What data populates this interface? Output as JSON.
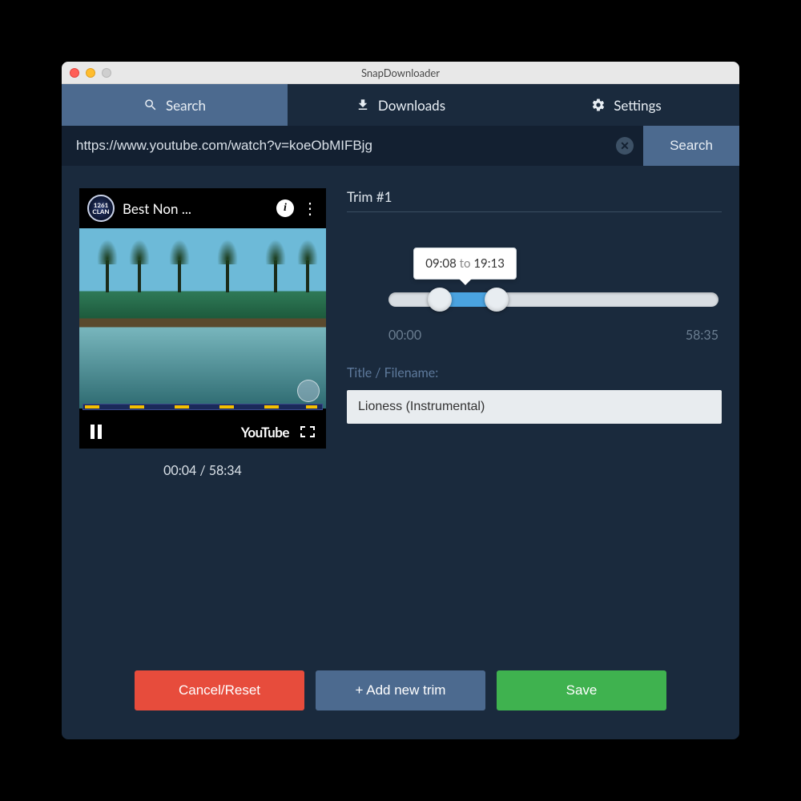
{
  "window": {
    "title": "SnapDownloader"
  },
  "tabs": {
    "search": "Search",
    "downloads": "Downloads",
    "settings": "Settings",
    "active": "search"
  },
  "search": {
    "url": "https://www.youtube.com/watch?v=koeObMIFBjg",
    "button": "Search"
  },
  "preview": {
    "channel_badge": "1261 CLAN",
    "title": "Best Non ...",
    "provider": "YouTube",
    "time_display": "00:04 / 58:34"
  },
  "trim": {
    "heading": "Trim #1",
    "tooltip_start": "09:08",
    "tooltip_to": "to",
    "tooltip_end": "19:13",
    "range_start_pct": 15.6,
    "range_end_pct": 32.8,
    "label_start": "00:00",
    "label_end": "58:35",
    "filename_label": "Title / Filename:",
    "filename_value": "Lioness (Instrumental)"
  },
  "actions": {
    "cancel": "Cancel/Reset",
    "add": "+ Add new trim",
    "save": "Save"
  },
  "icons": {
    "search": "search-icon",
    "download": "download-icon",
    "settings": "gear-icon",
    "clear": "clear-icon",
    "info": "info-icon",
    "more": "more-icon",
    "pause": "pause-icon",
    "fullscreen": "fullscreen-icon"
  }
}
